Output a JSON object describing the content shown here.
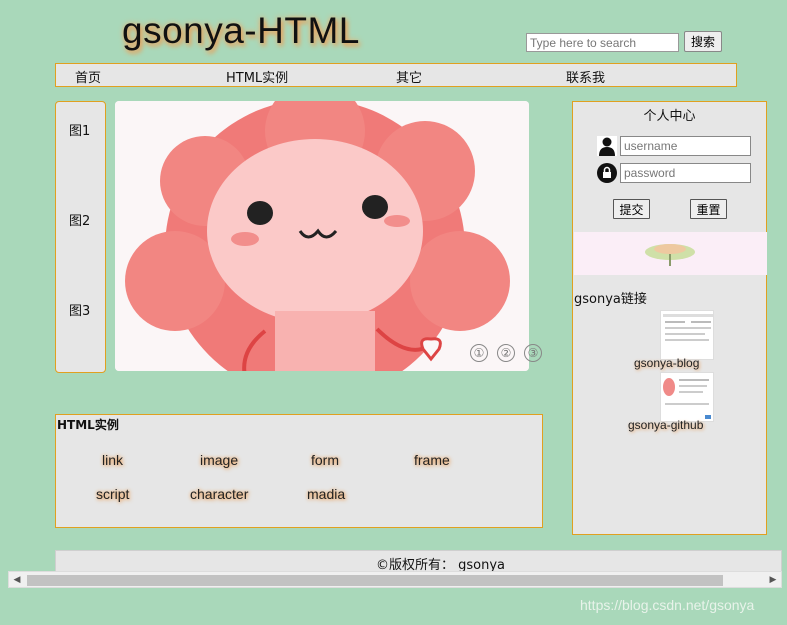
{
  "header": {
    "title": "gsonya-HTML",
    "search_placeholder": "Type here to search",
    "search_button": "搜索"
  },
  "nav": {
    "items": [
      {
        "label": "首页"
      },
      {
        "label": "HTML实例"
      },
      {
        "label": "其它"
      },
      {
        "label": "联系我"
      }
    ]
  },
  "thumbs": [
    {
      "label": "图1"
    },
    {
      "label": "图2"
    },
    {
      "label": "图3"
    }
  ],
  "slider": {
    "pages": [
      "①",
      "②",
      "③"
    ]
  },
  "profile": {
    "title": "个人中心",
    "username_placeholder": "username",
    "password_placeholder": "password",
    "submit_label": "提交",
    "reset_label": "重置",
    "links_heading": "gsonya链接",
    "links": [
      {
        "label": "gsonya-blog"
      },
      {
        "label": "gsonya-github"
      }
    ]
  },
  "examples": {
    "title": "HTML实例",
    "items": [
      {
        "label": "link"
      },
      {
        "label": "image"
      },
      {
        "label": "form"
      },
      {
        "label": "frame"
      },
      {
        "label": "script"
      },
      {
        "label": "character"
      },
      {
        "label": "madia"
      }
    ]
  },
  "footer": {
    "text": "©版权所有： gsonya"
  },
  "watermark": "https://blog.csdn.net/gsonya",
  "colors": {
    "background": "#a9d8ba",
    "panel": "#e6e6e6",
    "border_accent": "#e0a020",
    "glow": "#e8a060"
  },
  "icons": {
    "user": "user-icon",
    "lock": "lock-icon"
  }
}
